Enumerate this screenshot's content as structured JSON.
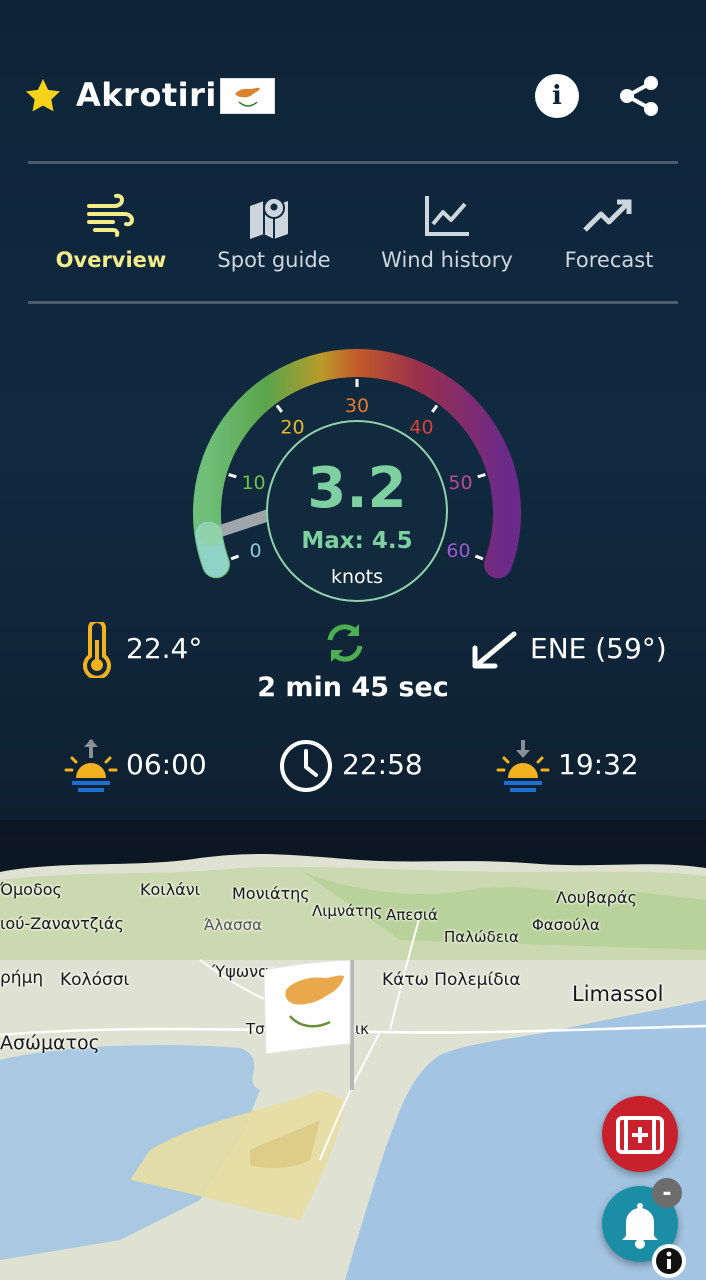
{
  "header": {
    "spot_name": "Akrotiri",
    "favorite": true,
    "country_flag": "cyprus-flag",
    "info_icon": "info-icon",
    "share_icon": "share-icon"
  },
  "tabs": [
    {
      "label": "Overview",
      "icon": "wind-icon",
      "active": true
    },
    {
      "label": "Spot guide",
      "icon": "map-icon",
      "active": false
    },
    {
      "label": "Wind history",
      "icon": "line-chart-icon",
      "active": false
    },
    {
      "label": "Forecast",
      "icon": "trend-up-icon",
      "active": false
    }
  ],
  "gauge": {
    "ticks": [
      "0",
      "10",
      "20",
      "30",
      "40",
      "50",
      "60"
    ],
    "speed": "3.2",
    "speed_value": 3.2,
    "max_label": "Max: 4.5",
    "max_value": 4.5,
    "unit": "knots",
    "range": [
      0,
      60
    ]
  },
  "stats": {
    "temperature": "22.4°",
    "last_update": "2 min 45 sec",
    "direction": "ENE (59°)",
    "sunrise": "06:00",
    "current_time": "22:58",
    "sunset": "19:32"
  },
  "map": {
    "labels": [
      "Όμοδος",
      "Κοιλάνι",
      "Μονιάτης",
      "Λουβαράς",
      "ιού-Ζαναντζιάς",
      "Λιμνάτης",
      "Απεσιά",
      "Φασούλα",
      "Άλασσα",
      "Παλώδεια",
      "ρήμη",
      "Κολόσσι",
      "Ύψωνας",
      "Κάτω Πολεμίδια",
      "Limassol",
      "Τσ",
      "ικ",
      "Ασώματος"
    ],
    "marker_flag": "cyprus-flag"
  },
  "floating_buttons": {
    "first_aid": "first-aid-icon",
    "notifications": "bell-icon",
    "badge": "-",
    "map_info": "i"
  },
  "colors": {
    "background": "#0d2438",
    "active_tab": "#f4ec8b",
    "speed_text": "#7fd0a0",
    "first_aid": "#c8202d",
    "bell": "#1b8ea6"
  }
}
